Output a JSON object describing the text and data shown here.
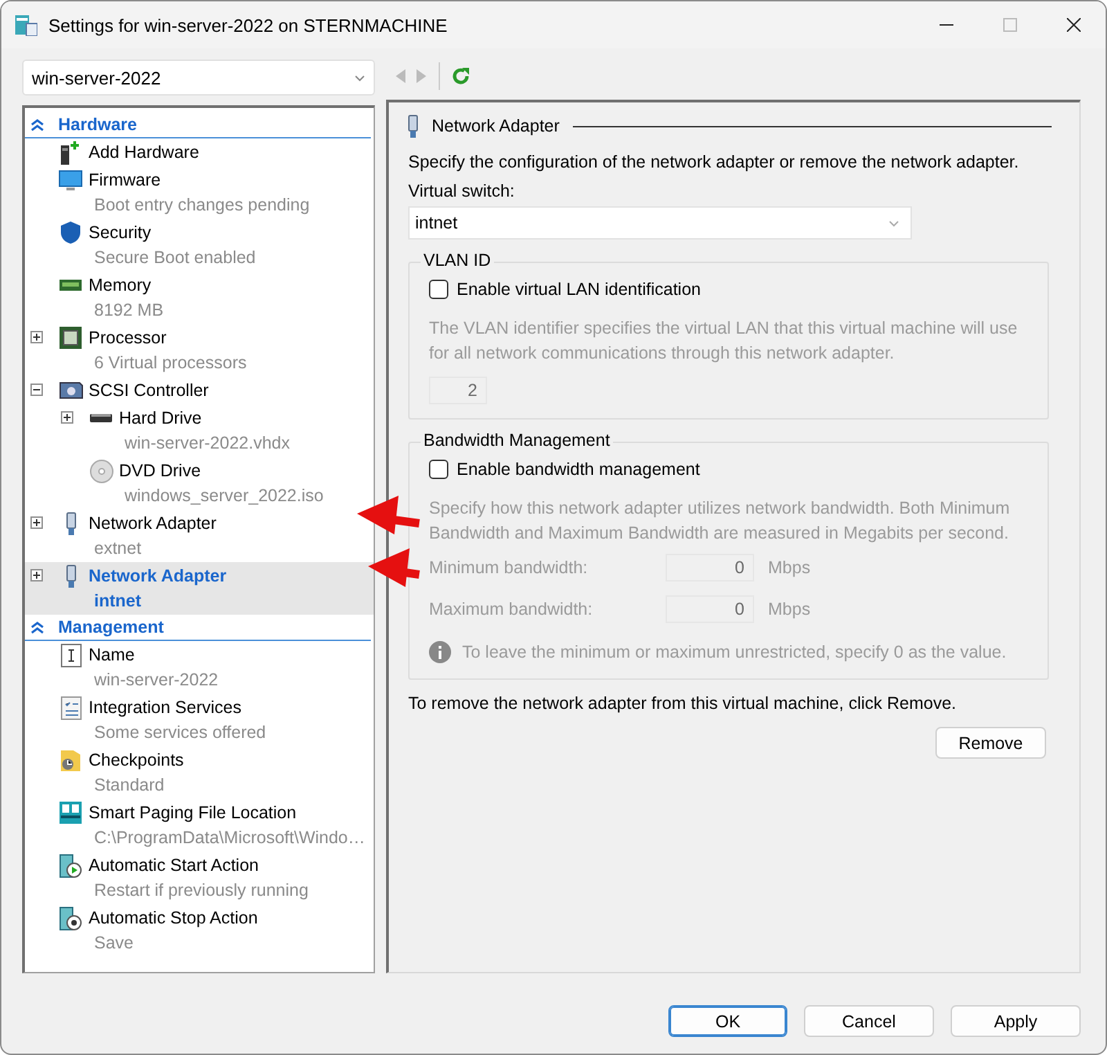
{
  "window": {
    "title": "Settings for win-server-2022 on STERNMACHINE"
  },
  "vm_selector": {
    "value": "win-server-2022"
  },
  "sidebar": {
    "sections": [
      {
        "title": "Hardware",
        "expanded": true,
        "items": [
          {
            "kind": "add-hardware",
            "label": "Add Hardware",
            "selected": false
          },
          {
            "kind": "firmware",
            "label": "Firmware",
            "detail": "Boot entry changes pending",
            "selected": false
          },
          {
            "kind": "security",
            "label": "Security",
            "detail": "Secure Boot enabled",
            "selected": false
          },
          {
            "kind": "memory",
            "label": "Memory",
            "detail": "8192 MB",
            "selected": false
          },
          {
            "kind": "processor",
            "label": "Processor",
            "detail": "6 Virtual processors",
            "expanded": false,
            "selected": false
          },
          {
            "kind": "scsi",
            "label": "SCSI Controller",
            "expanded": true,
            "selected": false,
            "children": [
              {
                "kind": "hard-drive",
                "label": "Hard Drive",
                "detail": "win-server-2022.vhdx",
                "expanded": false,
                "selected": false
              },
              {
                "kind": "dvd",
                "label": "DVD Drive",
                "detail": "windows_server_2022.iso",
                "selected": false
              }
            ]
          },
          {
            "kind": "network",
            "label": "Network Adapter",
            "detail": "extnet",
            "expanded": false,
            "selected": false
          },
          {
            "kind": "network",
            "label": "Network Adapter",
            "detail": "intnet",
            "expanded": false,
            "selected": true
          }
        ]
      },
      {
        "title": "Management",
        "expanded": true,
        "items": [
          {
            "kind": "name",
            "label": "Name",
            "detail": "win-server-2022",
            "selected": false
          },
          {
            "kind": "integration",
            "label": "Integration Services",
            "detail": "Some services offered",
            "selected": false
          },
          {
            "kind": "checkpoints",
            "label": "Checkpoints",
            "detail": "Standard",
            "selected": false
          },
          {
            "kind": "paging",
            "label": "Smart Paging File Location",
            "detail": "C:\\ProgramData\\Microsoft\\Windo…",
            "selected": false
          },
          {
            "kind": "start",
            "label": "Automatic Start Action",
            "detail": "Restart if previously running",
            "selected": false
          },
          {
            "kind": "stop",
            "label": "Automatic Stop Action",
            "detail": "Save",
            "selected": false
          }
        ]
      }
    ]
  },
  "panel": {
    "title": "Network Adapter",
    "description": "Specify the configuration of the network adapter or remove the network adapter.",
    "switch_label": "Virtual switch:",
    "switch_value": "intnet",
    "vlan": {
      "title": "VLAN ID",
      "checkbox": {
        "label": "Enable virtual LAN identification",
        "checked": false
      },
      "help": "The VLAN identifier specifies the virtual LAN that this virtual machine will use for all network communications through this network adapter.",
      "value": "2"
    },
    "bandwidth": {
      "title": "Bandwidth Management",
      "checkbox": {
        "label": "Enable bandwidth management",
        "checked": false
      },
      "help": "Specify how this network adapter utilizes network bandwidth. Both Minimum Bandwidth and Maximum Bandwidth are measured in Megabits per second.",
      "rows": [
        {
          "label": "Minimum bandwidth:",
          "value": "0",
          "unit": "Mbps"
        },
        {
          "label": "Maximum bandwidth:",
          "value": "0",
          "unit": "Mbps"
        }
      ],
      "info": "To leave the minimum or maximum unrestricted, specify 0 as the value."
    },
    "remove_note": "To remove the network adapter from this virtual machine, click Remove.",
    "remove_button": "Remove"
  },
  "buttons": [
    {
      "label": "OK",
      "default": true
    },
    {
      "label": "Cancel",
      "default": false
    },
    {
      "label": "Apply",
      "default": false
    }
  ]
}
